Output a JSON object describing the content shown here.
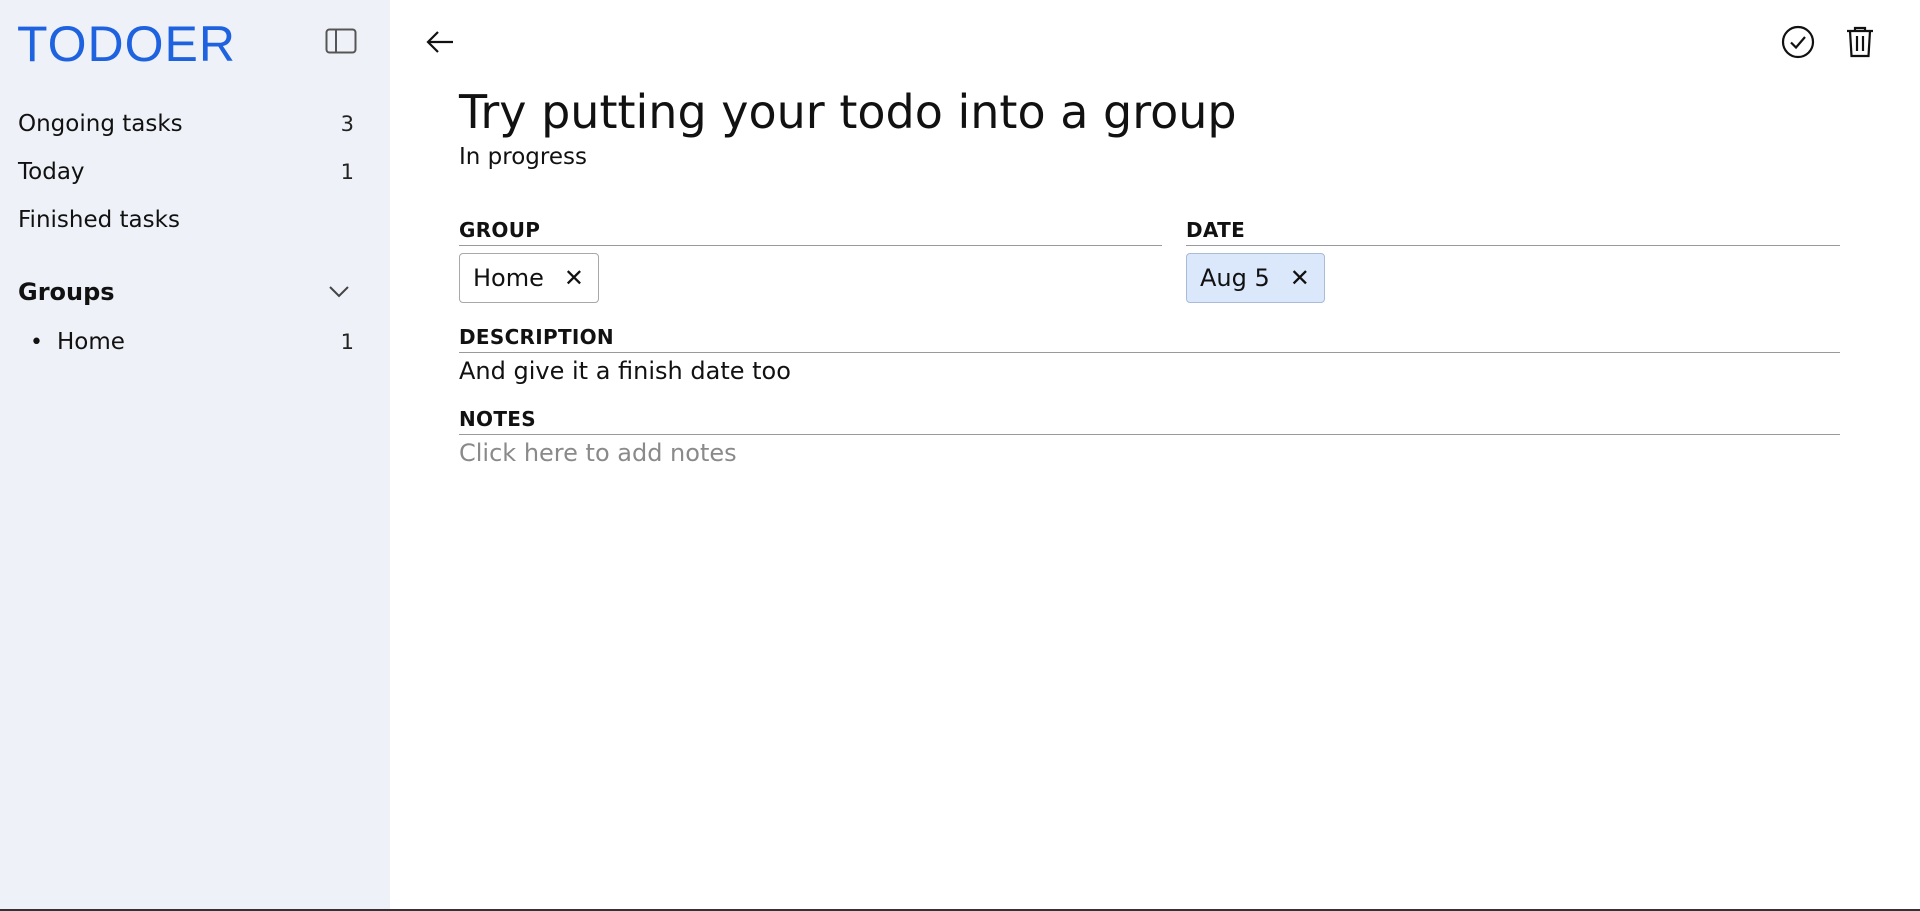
{
  "app": {
    "logo": "TODOER"
  },
  "sidebar": {
    "items": [
      {
        "label": "Ongoing tasks",
        "count": "3"
      },
      {
        "label": "Today",
        "count": "1"
      },
      {
        "label": "Finished tasks",
        "count": ""
      }
    ],
    "groups_title": "Groups",
    "groups": [
      {
        "name": "Home",
        "count": "1"
      }
    ]
  },
  "task": {
    "title": "Try putting your todo into a group",
    "status": "In progress",
    "group_label": "GROUP",
    "group_value": "Home",
    "date_label": "DATE",
    "date_value": "Aug 5",
    "description_label": "DESCRIPTION",
    "description_value": "And give it a finish date too",
    "notes_label": "NOTES",
    "notes_placeholder": "Click here to add notes"
  },
  "icons": {
    "sidebar_toggle": "sidebar-toggle-icon",
    "groups_chevron": "chevron-down-icon",
    "back": "arrow-left-icon",
    "complete": "check-circle-icon",
    "delete": "trash-icon",
    "remove": "close-icon"
  }
}
